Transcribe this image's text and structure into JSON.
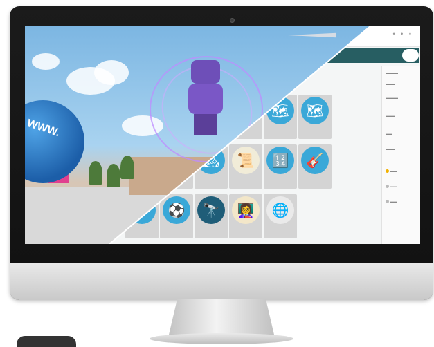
{
  "world": {
    "sign_text": "WWW."
  },
  "topbar": {
    "menu_glyph": "• • •"
  },
  "tiles": [
    {
      "icon": "science-icon",
      "glyph": "🧪",
      "color": "#3aa8d8",
      "label": ""
    },
    {
      "icon": "theatre-icon",
      "glyph": "🎭",
      "color": "#3aa8d8",
      "label": ""
    },
    {
      "icon": "africa-map-icon",
      "glyph": "🌍",
      "color": "#3aa8d8",
      "label": ""
    },
    {
      "icon": "europe-map-icon",
      "glyph": "🗺",
      "color": "#3aa8d8",
      "label": ""
    },
    {
      "icon": "asia-map-icon",
      "glyph": "🗺",
      "color": "#3aa8d8",
      "label": ""
    },
    {
      "icon": "australia-map-icon",
      "glyph": "🗺",
      "color": "#3aa8d8",
      "label": ""
    },
    {
      "icon": "mountain-icon",
      "glyph": "🏔",
      "color": "#3aa8d8",
      "label": ""
    },
    {
      "icon": "scroll-icon",
      "glyph": "📜",
      "color": "#f1ecd8",
      "label": ""
    },
    {
      "icon": "blocks-icon",
      "glyph": "🔢",
      "color": "#3aa8d8",
      "label": ""
    },
    {
      "icon": "guitar-icon",
      "glyph": "🎸",
      "color": "#3aa8d8",
      "label": ""
    },
    {
      "icon": "heart-icon",
      "glyph": "💗",
      "color": "#3aa8d8",
      "label": ""
    },
    {
      "icon": "soccer-ball-icon",
      "glyph": "⚽",
      "color": "#3aa8d8",
      "label": ""
    },
    {
      "icon": "telescope-icon",
      "glyph": "🔭",
      "color": "#1f5d78",
      "label": ""
    },
    {
      "icon": "teacher-icon",
      "glyph": "👩‍🏫",
      "color": "#f3e7c9",
      "label": ""
    },
    {
      "icon": "globe-icon",
      "glyph": "🌐",
      "color": "#eaeaea",
      "label": ""
    }
  ],
  "colors": {
    "accent": "#275e62",
    "tile_bg": "#d4d4d4"
  }
}
